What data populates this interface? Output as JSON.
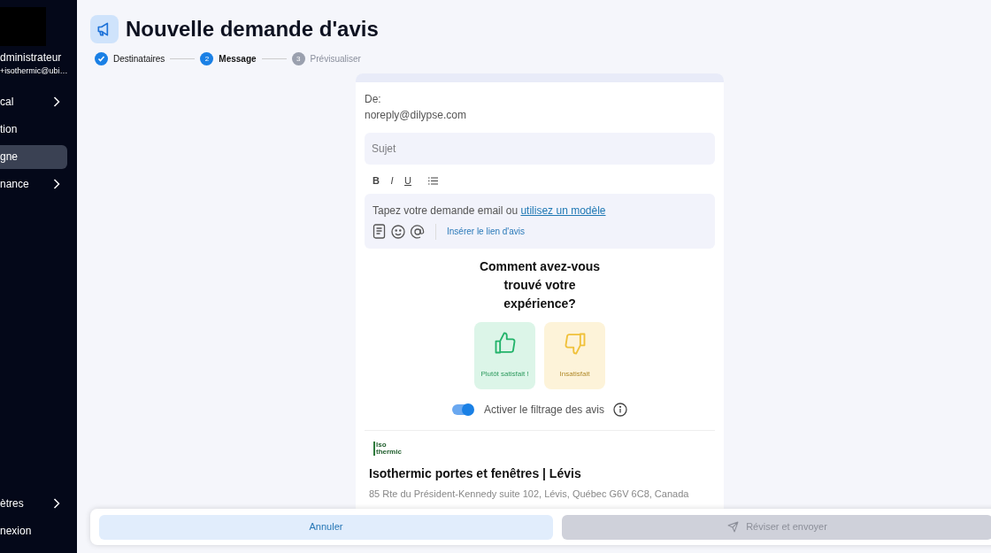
{
  "sidebar": {
    "user_role": "dministrateur",
    "user_email": "+isothermic@ubi…",
    "items": [
      {
        "label": "cal",
        "expandable": true,
        "selected": false
      },
      {
        "label": "tion",
        "expandable": false,
        "selected": false
      },
      {
        "label": "gne",
        "expandable": false,
        "selected": true
      },
      {
        "label": "nance",
        "expandable": true,
        "selected": false
      }
    ],
    "bottom_items": [
      {
        "label": "ètres",
        "expandable": true,
        "selected": false
      },
      {
        "label": "nexion",
        "expandable": false,
        "selected": false
      }
    ]
  },
  "page": {
    "title": "Nouvelle demande d'avis",
    "steps": [
      {
        "label": "Destinataires",
        "completed": true,
        "selected": false
      },
      {
        "number": "2",
        "label": "Message",
        "completed": false,
        "selected": true
      },
      {
        "number": "3",
        "label": "Prévisualiser",
        "completed": false,
        "selected": false
      }
    ]
  },
  "email": {
    "from_label": "De:",
    "from_address": "noreply@dilypse.com",
    "subject": {
      "placeholder": "Sujet"
    },
    "format_buttons": [
      "B",
      "I",
      "U"
    ],
    "body_text": "Tapez votre demande email ou ",
    "template_link": "utilisez un modèle",
    "insert_link": "Insérer le lien d'avis",
    "question": "Comment avez-vous trouvé votre expérience?",
    "choices": [
      {
        "kind": "positive",
        "label": "Plutôt satisfait !"
      },
      {
        "kind": "negative",
        "label": "Insatisfait"
      }
    ],
    "filter_toggle": {
      "label": "Activer le filtrage des avis",
      "on": true
    },
    "logo_text": [
      "Iso",
      "thermic"
    ],
    "business_name": "Isothermic portes et fenêtres | Lévis",
    "business_address": "85 Rte du Président-Kennedy suite 102, Lévis, Québec G6V 6C8, Canada"
  },
  "footer": {
    "cancel": "Annuler",
    "submit": {
      "label": "Réviser et envoyer",
      "disabled": true
    }
  }
}
